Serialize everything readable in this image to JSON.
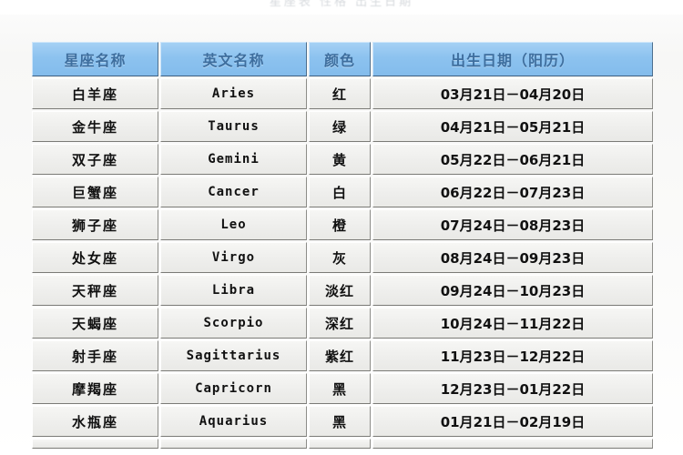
{
  "page": {
    "top_clipped_text": "星座表  性格  出生日期",
    "background_color": "#f9f9f8"
  },
  "table": {
    "name": "zodiac-sign-table",
    "header_bg": "#8cc2ef",
    "header_text_color": "#3e6e9e",
    "cell_bg": "#eeeeec",
    "cell_text_color": "#111111",
    "columns": [
      "星座名称",
      "英文名称",
      "颜色",
      "出生日期（阳历）"
    ],
    "rows": [
      {
        "name": "白羊座",
        "english": "Aries",
        "color": "红",
        "date": "03月21日－04月20日"
      },
      {
        "name": "金牛座",
        "english": "Taurus",
        "color": "绿",
        "date": "04月21日－05月21日"
      },
      {
        "name": "双子座",
        "english": "Gemini",
        "color": "黄",
        "date": "05月22日－06月21日"
      },
      {
        "name": "巨蟹座",
        "english": "Cancer",
        "color": "白",
        "date": "06月22日－07月23日"
      },
      {
        "name": "狮子座",
        "english": "Leo",
        "color": "橙",
        "date": "07月24日－08月23日"
      },
      {
        "name": "处女座",
        "english": "Virgo",
        "color": "灰",
        "date": "08月24日－09月23日"
      },
      {
        "name": "天秤座",
        "english": "Libra",
        "color": "淡红",
        "date": "09月24日－10月23日"
      },
      {
        "name": "天蝎座",
        "english": "Scorpio",
        "color": "深红",
        "date": "10月24日－11月22日"
      },
      {
        "name": "射手座",
        "english": "Sagittarius",
        "color": "紫红",
        "date": "11月23日－12月22日"
      },
      {
        "name": "摩羯座",
        "english": "Capricorn",
        "color": "黑",
        "date": "12月23日－01月22日"
      },
      {
        "name": "水瓶座",
        "english": "Aquarius",
        "color": "黑",
        "date": "01月21日－02月19日"
      }
    ]
  }
}
